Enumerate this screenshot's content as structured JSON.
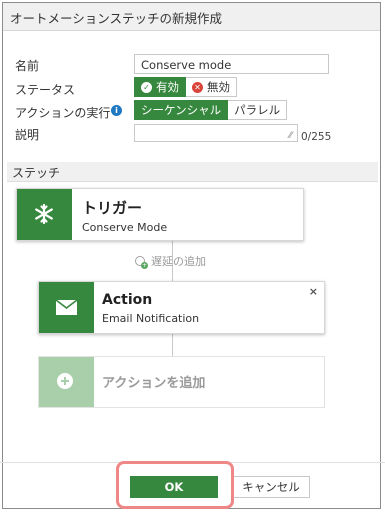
{
  "dialog": {
    "title": "オートメーションステッチの新規作成"
  },
  "form": {
    "name_label": "名前",
    "name_value": "Conserve mode",
    "status_label": "ステータス",
    "status_enabled": "有効",
    "status_disabled": "無効",
    "status_selected": "enabled",
    "execution_label": "アクションの実行",
    "execution_sequential": "シーケンシャル",
    "execution_parallel": "パラレル",
    "execution_selected": "sequential",
    "description_label": "説明",
    "description_value": "",
    "description_counter": "0/255"
  },
  "stitch": {
    "section_label": "ステッチ",
    "trigger": {
      "title": "トリガー",
      "subtitle": "Conserve Mode",
      "icon": "snowflake-icon"
    },
    "delay_label": "遅延の追加",
    "action": {
      "title": "Action",
      "subtitle": "Email Notification",
      "icon": "envelope-icon",
      "close": "×"
    },
    "add_action_label": "アクションを追加"
  },
  "footer": {
    "ok_label": "OK",
    "cancel_label": "キャンセル"
  },
  "colors": {
    "accent": "#37883f",
    "accent_light": "#a8cfa9",
    "disabled_red": "#d9443a",
    "highlight": "#ee8786",
    "info_blue": "#1f78c1"
  }
}
